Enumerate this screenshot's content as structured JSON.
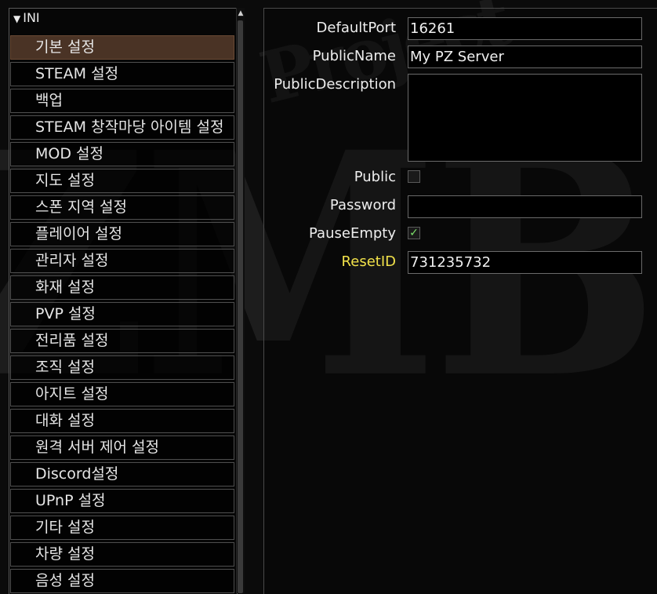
{
  "tree": {
    "root_label": "INI",
    "items": [
      {
        "label": "기본 설정",
        "selected": true
      },
      {
        "label": "STEAM 설정"
      },
      {
        "label": "백업"
      },
      {
        "label": "STEAM 창작마당 아이템 설정"
      },
      {
        "label": "MOD 설정"
      },
      {
        "label": "지도 설정"
      },
      {
        "label": "스폰 지역 설정"
      },
      {
        "label": "플레이어 설정"
      },
      {
        "label": "관리자 설정"
      },
      {
        "label": "화재 설정"
      },
      {
        "label": "PVP 설정"
      },
      {
        "label": "전리품 설정"
      },
      {
        "label": "조직 설정"
      },
      {
        "label": "아지트 설정"
      },
      {
        "label": "대화 설정"
      },
      {
        "label": "원격 서버 제어 설정"
      },
      {
        "label": "Discord설정"
      },
      {
        "label": "UPnP 설정"
      },
      {
        "label": "기타 설정"
      },
      {
        "label": "차량 설정"
      },
      {
        "label": "음성 설정"
      }
    ]
  },
  "settings": {
    "default_port": {
      "label": "DefaultPort",
      "value": "16261"
    },
    "public_name": {
      "label": "PublicName",
      "value": "My PZ Server"
    },
    "public_description": {
      "label": "PublicDescription",
      "value": ""
    },
    "public": {
      "label": "Public",
      "checked": false
    },
    "password": {
      "label": "Password",
      "value": ""
    },
    "pause_empty": {
      "label": "PauseEmpty",
      "checked": true,
      "mark": "✓"
    },
    "reset_id": {
      "label": "ResetID",
      "value": "731235732"
    }
  },
  "colors": {
    "highlight_label": "#f2e24a",
    "selected_item": "#4a3325",
    "check_mark": "#7ce06a"
  }
}
